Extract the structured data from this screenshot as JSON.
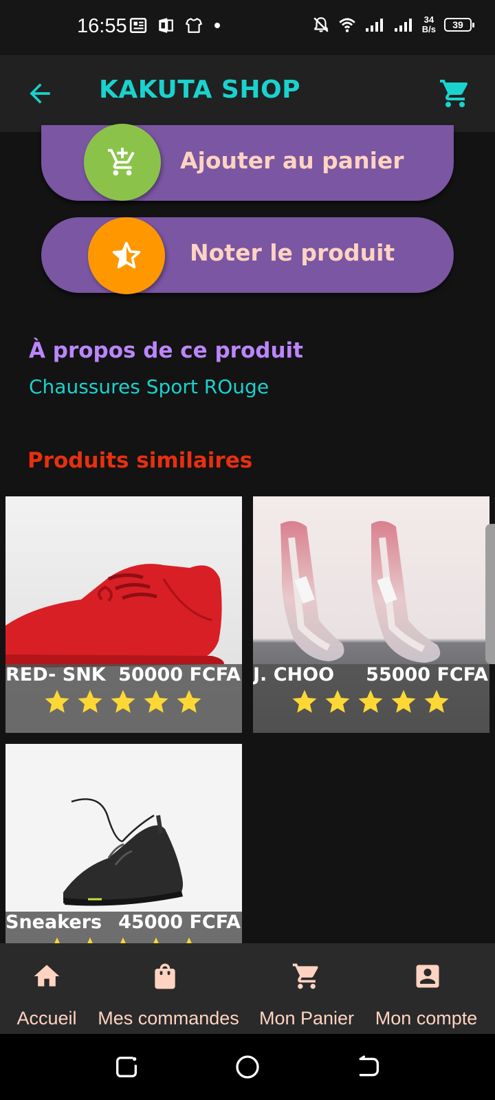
{
  "status_bar": {
    "time": "16:55",
    "net_speed_value": "34",
    "net_speed_unit": "B/s",
    "battery": "39"
  },
  "app_bar": {
    "title": "KAKUTA SHOP"
  },
  "actions": {
    "add_to_cart": "Ajouter au panier",
    "rate_product": "Noter le  produit"
  },
  "about": {
    "heading": "À propos de ce produit",
    "description": "Chaussures Sport ROuge"
  },
  "similar": {
    "heading": "Produits similaires",
    "products": [
      {
        "name": "RED- SNK",
        "price": "50000 FCFA",
        "rating": 5
      },
      {
        "name": "J. CHOO",
        "price": "55000 FCFA",
        "rating": 5
      },
      {
        "name": "Sneakers",
        "price": "45000 FCFA",
        "rating": 5
      }
    ]
  },
  "bottom_nav": {
    "items": [
      {
        "label": "Accueil",
        "icon": "home-icon"
      },
      {
        "label": "Mes commandes",
        "icon": "shopping-bag-icon"
      },
      {
        "label": "Mon Panier",
        "icon": "cart-icon"
      },
      {
        "label": "Mon compte",
        "icon": "account-box-icon"
      }
    ]
  },
  "colors": {
    "accent": "#1ad2ce",
    "pill": "#7a56a3",
    "add_circle": "#8bc34a",
    "rate_circle": "#ff9800",
    "about_heading": "#bb86fc",
    "similar_heading": "#e7300f",
    "star": "#fdd835"
  }
}
